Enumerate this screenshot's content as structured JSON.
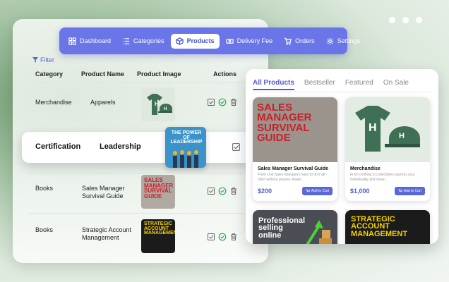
{
  "nav": {
    "items": [
      {
        "label": "Dashboard",
        "icon": "grid-icon"
      },
      {
        "label": "Categories",
        "icon": "list-icon"
      },
      {
        "label": "Products",
        "icon": "box-icon"
      },
      {
        "label": "Delivery Fee",
        "icon": "money-icon"
      },
      {
        "label": "Orders",
        "icon": "cart-icon"
      },
      {
        "label": "Settings",
        "icon": "gear-icon"
      }
    ],
    "active": "Products"
  },
  "filter_label": "Filter",
  "table": {
    "headers": [
      "Category",
      "Product Name",
      "Product Image",
      "Actions"
    ],
    "rows": [
      {
        "category": "Merchandise",
        "name": "Apparels"
      },
      {
        "category": "Certification",
        "name": "Leadership",
        "image_text": "THE POWER OF LEADERSHIP"
      },
      {
        "category": "Books",
        "name": "Sales Manager Survival Guide"
      },
      {
        "category": "Books",
        "name": "Strategic Account Management"
      }
    ]
  },
  "store": {
    "tabs": [
      "All Products",
      "Bestseller",
      "Featured",
      "On Sale"
    ],
    "active_tab": "All Products",
    "products": [
      {
        "cover": "SALES MANAGER SURVIVAL GUIDE",
        "title": "Sales Manager Survival Guide",
        "desc": "From Line Sales Managers have to do it all - often without anyone shown.",
        "price": "$200",
        "cart": "Add to Cart"
      },
      {
        "title": "Merchandise",
        "desc": "From clothing to collectibles express your individuality and show...",
        "price": "$1,000",
        "cart": "Add to Cart"
      },
      {
        "cover": "Professional selling online"
      },
      {
        "cover": "STRATEGIC ACCOUNT MANAGEMENT"
      }
    ]
  },
  "colors": {
    "accent": "#6a75e8",
    "brand_green": "#3f6f55",
    "book_red": "#c8202a",
    "book_yellow": "#f5d000"
  }
}
